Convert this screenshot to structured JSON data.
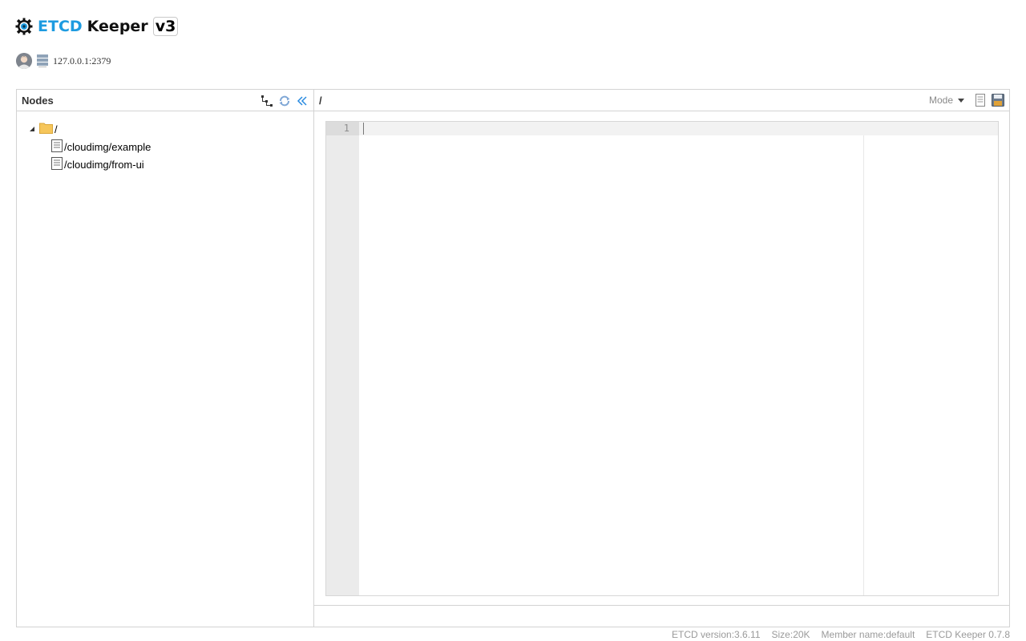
{
  "header": {
    "title_etcd": "ETCD",
    "title_keeper": "Keeper",
    "title_version": "v3",
    "logo_icon": "gear-eye-icon"
  },
  "server": {
    "address": "127.0.0.1:2379",
    "avatar_icon": "user-avatar-icon",
    "server_icon": "server-icon"
  },
  "nodes_panel": {
    "title": "Nodes",
    "tools": [
      "tree-layout-icon",
      "refresh-icon",
      "collapse-left-icon"
    ],
    "tree": {
      "root": {
        "label": "/",
        "icon": "folder-icon",
        "expanded": true
      },
      "children": [
        {
          "label": "/cloudimg/example",
          "icon": "file-icon"
        },
        {
          "label": "/cloudimg/from-ui",
          "icon": "file-icon"
        }
      ]
    }
  },
  "editor_panel": {
    "path": "/",
    "mode_label": "Mode",
    "tools": [
      "document-icon",
      "save-icon"
    ],
    "line_numbers": [
      "1"
    ]
  },
  "footer": {
    "etcd_version": "ETCD version:3.6.11",
    "size": "Size:20K",
    "member_name": "Member name:default",
    "keeper_version": "ETCD Keeper 0.7.8"
  },
  "colors": {
    "brand_blue": "#1e9be0",
    "border": "#d3d3d3",
    "muted_text": "#9a9a9a"
  }
}
